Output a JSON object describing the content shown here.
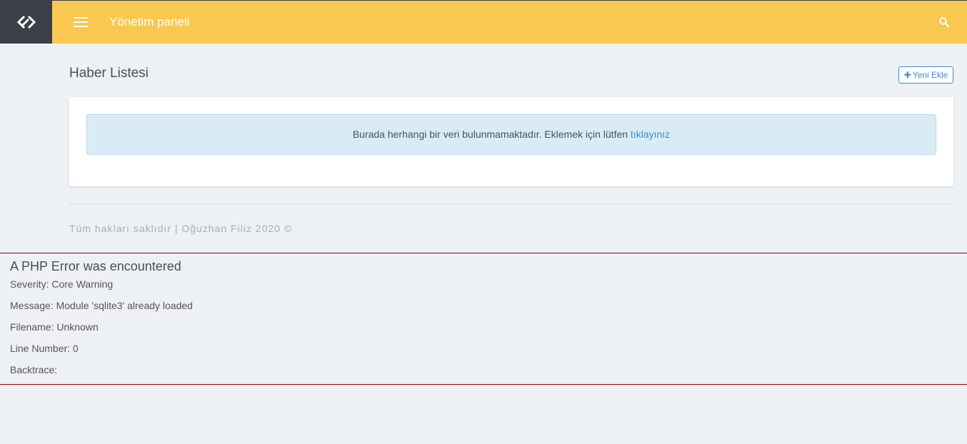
{
  "topbar": {
    "logo_icon": "logo-icon",
    "menu_icon": "hamburger-menu-icon",
    "title": "Yönetim paneli",
    "search_icon": "search-icon",
    "colors": {
      "bar": "#f9c851",
      "logo_bg": "#3a3f48"
    }
  },
  "page": {
    "title": "Haber Listesi",
    "add_button": {
      "icon": "plus-icon",
      "label": "Yeni Ekle"
    }
  },
  "alert": {
    "message": "Burada herhangi bir veri bulunmamaktadır. Eklemek için lütfen",
    "link_text": "tıklayınız"
  },
  "footer": {
    "text": "Tüm hakları saklıdır | Oğuzhan Filiz 2020 ©"
  },
  "php_error": {
    "heading": "A PHP Error was encountered",
    "severity": "Severity: Core Warning",
    "message": "Message: Module 'sqlite3' already loaded",
    "filename": "Filename: Unknown",
    "line_number": "Line Number: 0",
    "backtrace": "Backtrace:"
  }
}
